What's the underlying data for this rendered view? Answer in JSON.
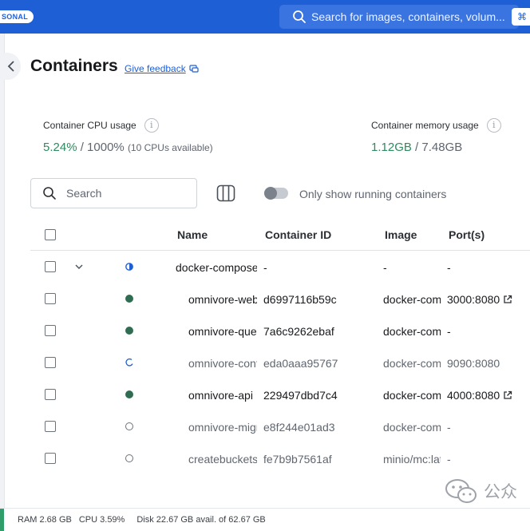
{
  "topbar": {
    "plan_badge": "SONAL",
    "search_placeholder": "Search for images, containers, volum...",
    "shortcut": "⌘"
  },
  "page": {
    "title": "Containers",
    "feedback_link": "Give feedback"
  },
  "stats": {
    "cpu": {
      "label": "Container CPU usage",
      "value": "5.24%",
      "sep": "/ 1000%",
      "note": "(10 CPUs available)"
    },
    "memory": {
      "label": "Container memory usage",
      "value": "1.12GB",
      "sep": "/ 7.48GB"
    }
  },
  "toolbar": {
    "search_placeholder": "Search",
    "toggle_label": "Only show running containers",
    "toggle_on": false
  },
  "table": {
    "columns": [
      "Name",
      "Container ID",
      "Image",
      "Port(s)"
    ],
    "rows": [
      {
        "name": "docker-compose",
        "id": "-",
        "image": "-",
        "ports": "-",
        "status": "partial",
        "group": true
      },
      {
        "name": "omnivore-web",
        "id": "d6997116b59c",
        "image": "docker-compose",
        "ports": "3000:8080",
        "status": "running",
        "link": true
      },
      {
        "name": "omnivore-queue",
        "id": "7a6c9262ebaf",
        "image": "docker-compose",
        "ports": "-",
        "status": "running"
      },
      {
        "name": "omnivore-content",
        "id": "eda0aaa95767",
        "image": "docker-compose",
        "ports": "9090:8080",
        "status": "starting"
      },
      {
        "name": "omnivore-api",
        "id": "229497dbd7c4",
        "image": "docker-compose",
        "ports": "4000:8080",
        "status": "running",
        "link": true
      },
      {
        "name": "omnivore-migrate",
        "id": "e8f244e01ad3",
        "image": "docker-compose",
        "ports": "-",
        "status": "exited"
      },
      {
        "name": "createbuckets",
        "id": "fe7b9b7561af",
        "image": "minio/mc:latest",
        "ports": "-",
        "status": "exited"
      }
    ]
  },
  "statusbar": {
    "ram": "RAM 2.68 GB",
    "cpu": "CPU 3.59%",
    "disk": "Disk 22.67 GB avail. of 62.67 GB"
  },
  "watermark": {
    "text": "公众"
  },
  "colors": {
    "brand": "#1f5fd6",
    "running": "#2f6d52",
    "value": "#2e8a5f"
  }
}
